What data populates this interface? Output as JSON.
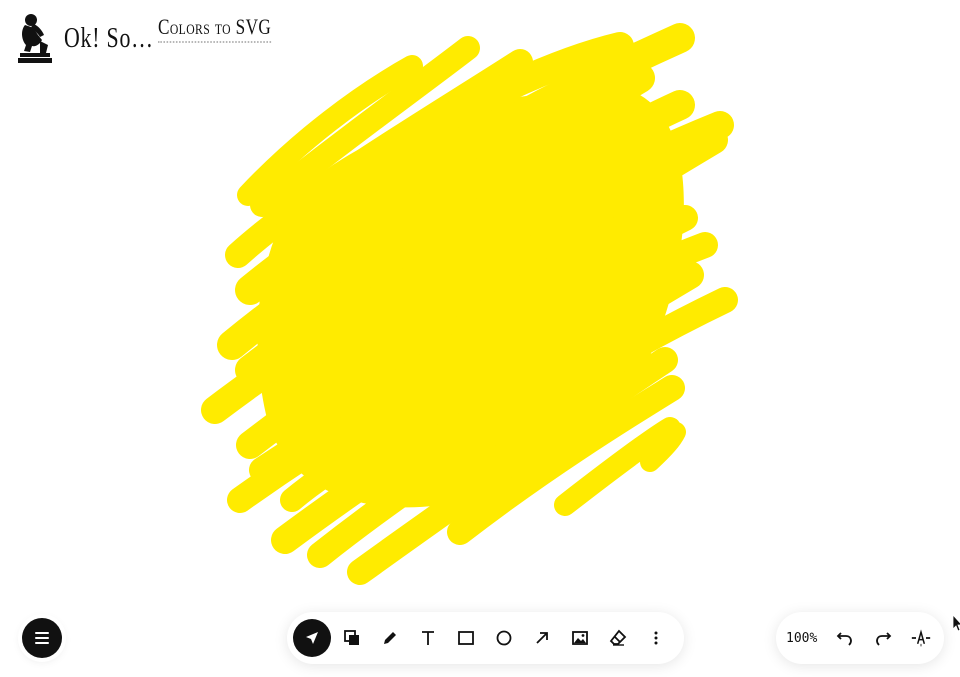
{
  "app": {
    "brand": "Ok! So…",
    "document_title": "Colors to SVG"
  },
  "canvas": {
    "stroke_color": "#FFEB00"
  },
  "menu": {
    "icon": "hamburger-menu-icon"
  },
  "toolbar": {
    "active_tool": "select",
    "tools": [
      {
        "name": "select",
        "icon": "cursor-arrow-icon"
      },
      {
        "name": "color",
        "icon": "color-swatch-icon"
      },
      {
        "name": "pen",
        "icon": "pencil-icon"
      },
      {
        "name": "text",
        "icon": "text-icon"
      },
      {
        "name": "rectangle",
        "icon": "rectangle-icon"
      },
      {
        "name": "ellipse",
        "icon": "circle-icon"
      },
      {
        "name": "arrow",
        "icon": "arrow-icon"
      },
      {
        "name": "image",
        "icon": "image-icon"
      },
      {
        "name": "eraser",
        "icon": "eraser-icon"
      },
      {
        "name": "more",
        "icon": "more-vertical-icon"
      }
    ]
  },
  "view": {
    "zoom_label": "100%",
    "undo_icon": "undo-icon",
    "redo_icon": "redo-icon",
    "style_icon": "text-style-icon"
  }
}
